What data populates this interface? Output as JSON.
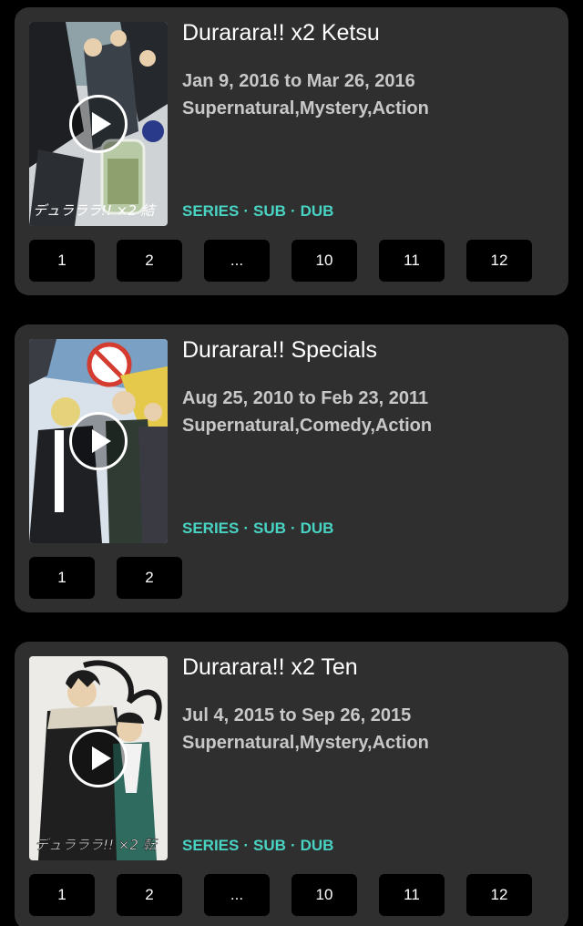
{
  "colors": {
    "background": "#000000",
    "card": "#2f2f2f",
    "accent_tags": "#48d3c3",
    "episode_button": "#000000"
  },
  "anime": [
    {
      "title": "Durarara!! x2 Ketsu",
      "dates": "Jan 9, 2016 to Mar 26, 2016",
      "genres": "Supernatural,Mystery,Action",
      "tags": [
        "SERIES",
        "SUB",
        "DUB"
      ],
      "episodes": [
        "1",
        "2",
        "...",
        "10",
        "11",
        "12"
      ],
      "poster_icon": "play-circle-icon",
      "poster_text": "デュラララ!! ×2 結"
    },
    {
      "title": "Durarara!! Specials",
      "dates": "Aug 25, 2010 to Feb 23, 2011",
      "genres": "Supernatural,Comedy,Action",
      "tags": [
        "SERIES",
        "SUB",
        "DUB"
      ],
      "episodes": [
        "1",
        "2"
      ],
      "poster_icon": "play-circle-icon"
    },
    {
      "title": "Durarara!! x2 Ten",
      "dates": "Jul 4, 2015 to Sep 26, 2015",
      "genres": "Supernatural,Mystery,Action",
      "tags": [
        "SERIES",
        "SUB",
        "DUB"
      ],
      "episodes": [
        "1",
        "2",
        "...",
        "10",
        "11",
        "12"
      ],
      "poster_icon": "play-circle-icon",
      "poster_text": "デュラララ!! ×2 転"
    }
  ]
}
